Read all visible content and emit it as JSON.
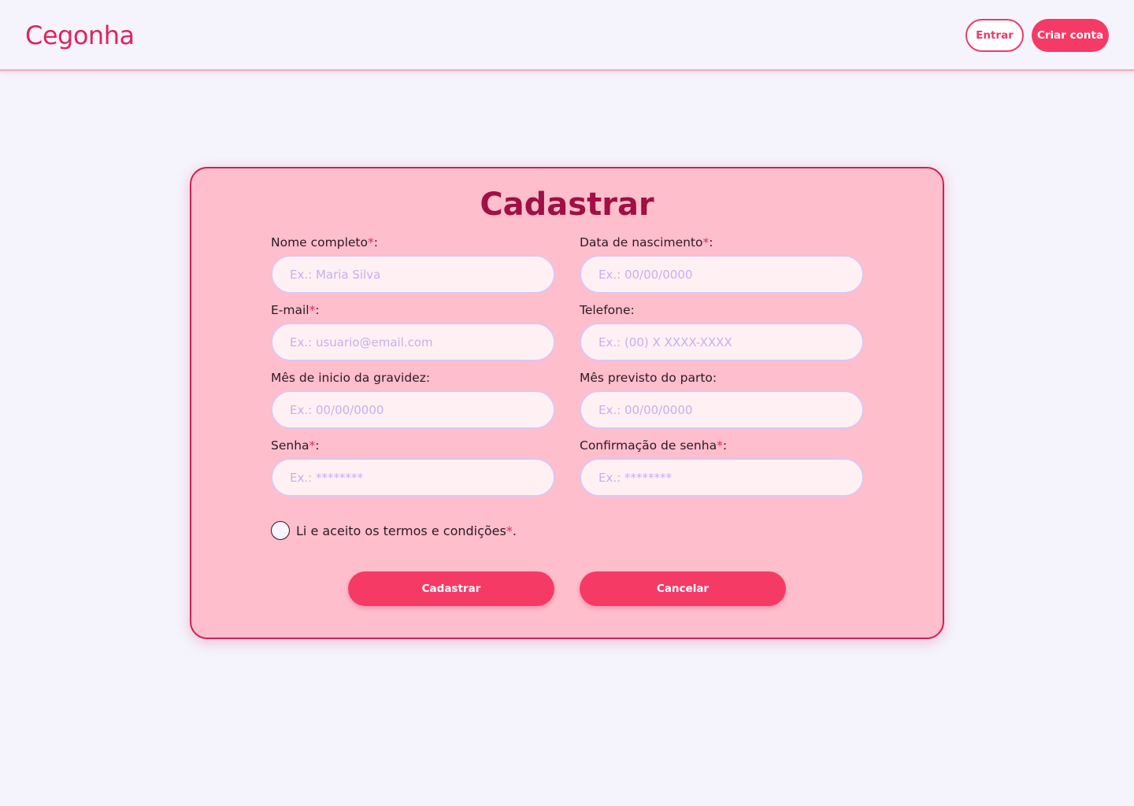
{
  "header": {
    "logo": "Cegonha",
    "login_label": "Entrar",
    "signup_label": "Criar conta"
  },
  "form": {
    "title": "Cadastrar",
    "fields": {
      "full_name": {
        "label": "Nome completo",
        "required": "*",
        "suffix": ":",
        "placeholder": "Ex.: Maria Silva",
        "value": ""
      },
      "birth_date": {
        "label": "Data de nascimento",
        "required": "*",
        "suffix": ":",
        "placeholder": "Ex.: 00/00/0000",
        "value": ""
      },
      "email": {
        "label": "E-mail",
        "required": "*",
        "suffix": ":",
        "placeholder": "Ex.: usuario@email.com",
        "value": ""
      },
      "phone": {
        "label": "Telefone:",
        "placeholder": "Ex.: (00) X XXXX-XXXX",
        "value": ""
      },
      "pregnancy_start": {
        "label": "Mês de inicio da gravidez:",
        "placeholder": "Ex.: 00/00/0000",
        "value": ""
      },
      "due_month": {
        "label": "Mês previsto do parto:",
        "placeholder": "Ex.: 00/00/0000",
        "value": ""
      },
      "password": {
        "label": "Senha",
        "required": "*",
        "suffix": ":",
        "placeholder": "Ex.: ********",
        "value": ""
      },
      "password_confirm": {
        "label": "Confirmação de senha",
        "required": "*",
        "suffix": ":",
        "placeholder": "Ex.: ********",
        "value": ""
      }
    },
    "terms": {
      "label": "Li e aceito os termos e condições",
      "required": "*",
      "suffix": ".",
      "checked": false
    },
    "submit_label": "Cadastrar",
    "cancel_label": "Cancelar"
  },
  "colors": {
    "page_background": "#f5f4fc",
    "accent": "#f63a66",
    "brand": "#e0245e",
    "card_background": "#ffbecc",
    "card_border": "#d21f55",
    "title": "#a01042",
    "input_background": "#fff0f3",
    "input_border": "#dcc6f2",
    "placeholder": "#c4b1ee"
  }
}
